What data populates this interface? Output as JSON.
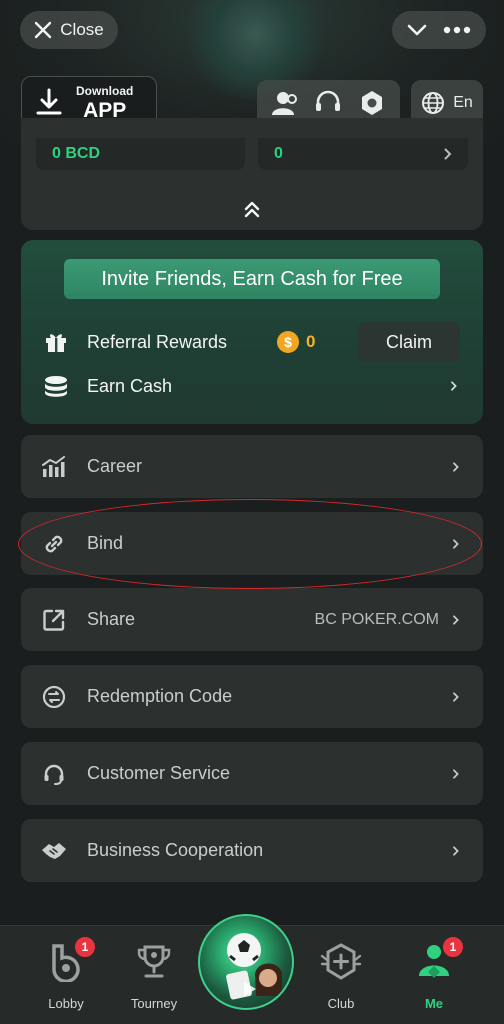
{
  "header": {
    "close_label": "Close",
    "download_small": "Download",
    "download_big": "APP",
    "language": "En"
  },
  "balance": {
    "left_value": "0 BCD",
    "right_value": "0"
  },
  "invite": {
    "banner": "Invite Friends, Earn Cash for Free",
    "referral_label": "Referral Rewards",
    "coin_symbol": "$",
    "referral_amount": "0",
    "claim_label": "Claim",
    "earn_cash_label": "Earn Cash"
  },
  "menu": [
    {
      "label": "Career",
      "icon": "chart-icon"
    },
    {
      "label": "Bind",
      "icon": "link-icon"
    },
    {
      "label": "Share",
      "value": "BC POKER.COM",
      "icon": "share-icon"
    },
    {
      "label": "Redemption Code",
      "icon": "redeem-icon"
    },
    {
      "label": "Customer Service",
      "icon": "headset-icon"
    },
    {
      "label": "Business Cooperation",
      "icon": "handshake-icon"
    }
  ],
  "nav": {
    "lobby": "Lobby",
    "lobby_badge": "1",
    "tourney": "Tourney",
    "club": "Club",
    "me": "Me",
    "me_badge": "1"
  },
  "colors": {
    "accent_green": "#2fd17e",
    "coin_gold": "#f3a621",
    "badge_red": "#e8343f",
    "annotation_red": "#d42a2a"
  }
}
